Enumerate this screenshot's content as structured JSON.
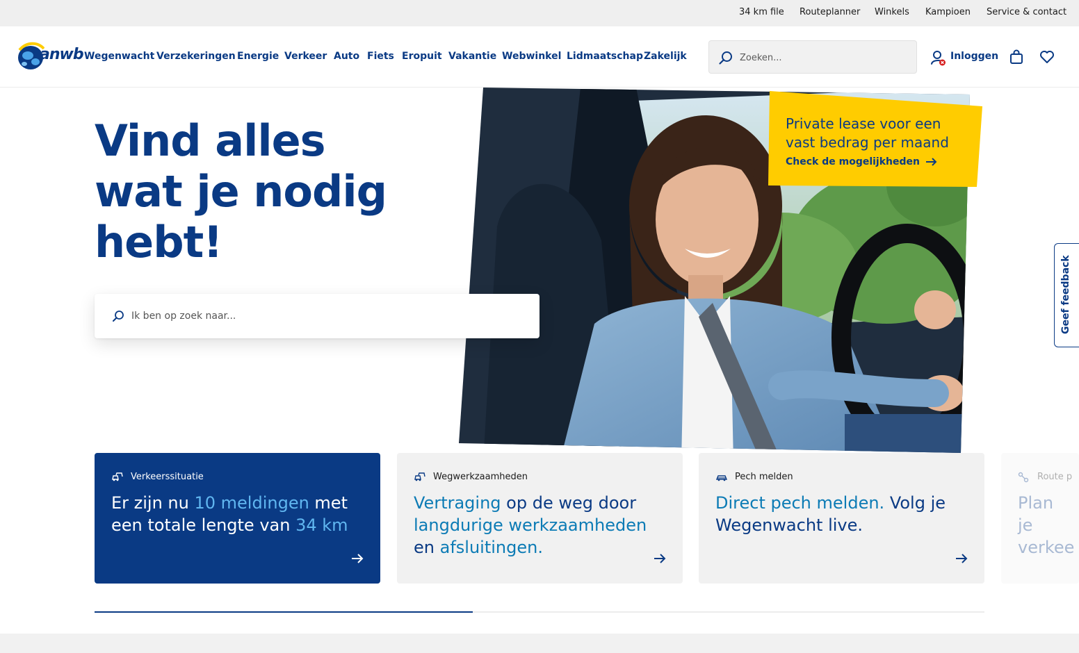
{
  "utility_nav": [
    "34 km file",
    "Routeplanner",
    "Winkels",
    "Kampioen",
    "Service & contact"
  ],
  "brand": {
    "logo_text": "anwb"
  },
  "main_nav": [
    "Wegenwacht",
    "Verzekeringen",
    "Energie",
    "Verkeer",
    "Auto",
    "Fiets",
    "Eropuit",
    "Vakantie",
    "Webwinkel",
    "Lidmaatschap",
    "Zakelijk"
  ],
  "header_search": {
    "placeholder": "Zoeken..."
  },
  "account": {
    "login_label": "Inloggen"
  },
  "hero": {
    "title_line1": "Vind alles",
    "title_line2": "wat je nodig",
    "title_line3": "hebt!",
    "search_placeholder": "Ik ben op zoek naar..."
  },
  "promo": {
    "title": "Private lease voor een vast bedrag per maand",
    "link_label": "Check de mogelijkheden"
  },
  "feedback": {
    "label": "Geef feedback"
  },
  "cards": [
    {
      "label": "Verkeerssituatie",
      "t1": "Er zijn nu ",
      "h1": "10 meldingen",
      "t2": " met een totale lengte van ",
      "h2": "34 km",
      "t3": ""
    },
    {
      "label": "Wegwerkzaamheden",
      "h1": "Vertraging",
      "t1": " op de weg door ",
      "h2": "langdurige werkzaamheden",
      "t2": " en ",
      "h3": "afsluitingen."
    },
    {
      "label": "Pech melden",
      "h1": "Direct pech melden.",
      "t1": " Volg je Wegenwacht live."
    },
    {
      "label": "Route p",
      "t1": "Plan je verkee"
    }
  ],
  "carousel": {
    "progress": 0.425
  },
  "colors": {
    "brand_blue": "#0a3a84",
    "accent_yellow": "#ffcc00",
    "link_blue": "#0c7bb5"
  }
}
